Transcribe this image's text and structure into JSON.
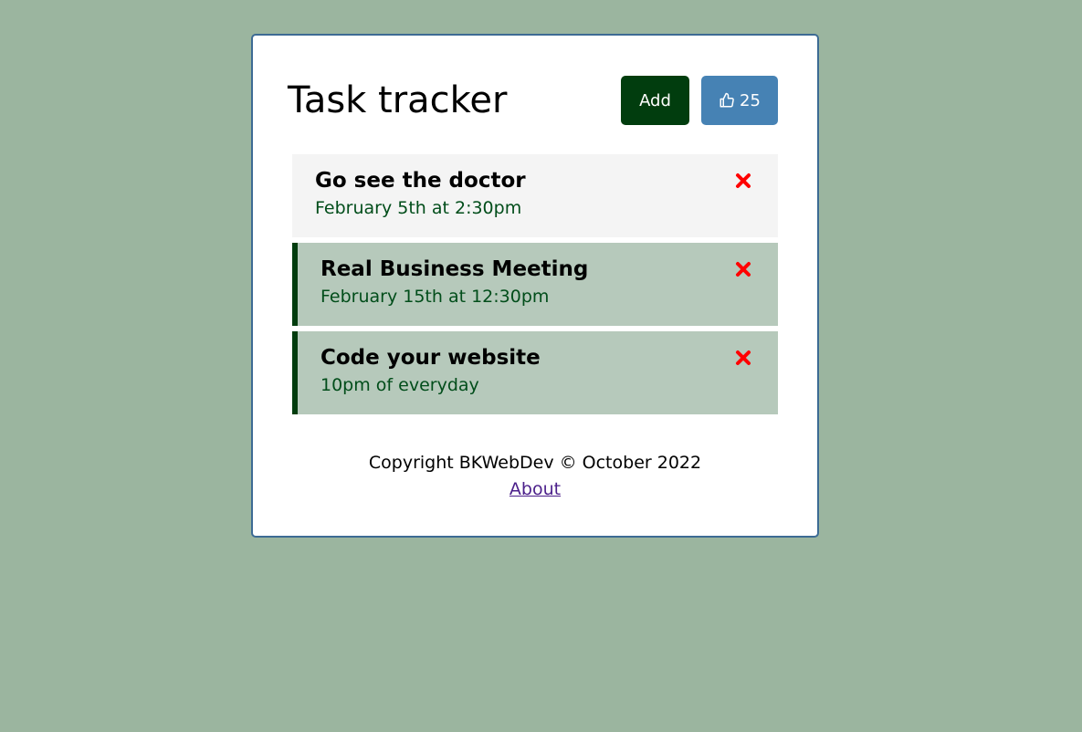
{
  "header": {
    "title": "Task tracker",
    "add_label": "Add",
    "like_count": "25",
    "like_icon": "thumbs-up-icon"
  },
  "tasks": [
    {
      "text": "Go see the doctor",
      "day": "February 5th at 2:30pm",
      "reminder": false
    },
    {
      "text": "Real Business Meeting",
      "day": "February 15th at 12:30pm",
      "reminder": true
    },
    {
      "text": "Code your website",
      "day": "10pm of everyday",
      "reminder": true
    }
  ],
  "footer": {
    "copyright": "Copyright BKWebDev © October 2022",
    "about_label": "About"
  },
  "colors": {
    "background": "#9bb59f",
    "card_border": "#3d6b94",
    "add_button": "#013d0e",
    "like_button": "#4682b4",
    "reminder_bg": "#b6c9bb",
    "reminder_border": "#013d0e",
    "delete_icon": "#ff0000",
    "task_day_text": "#014d1a"
  }
}
